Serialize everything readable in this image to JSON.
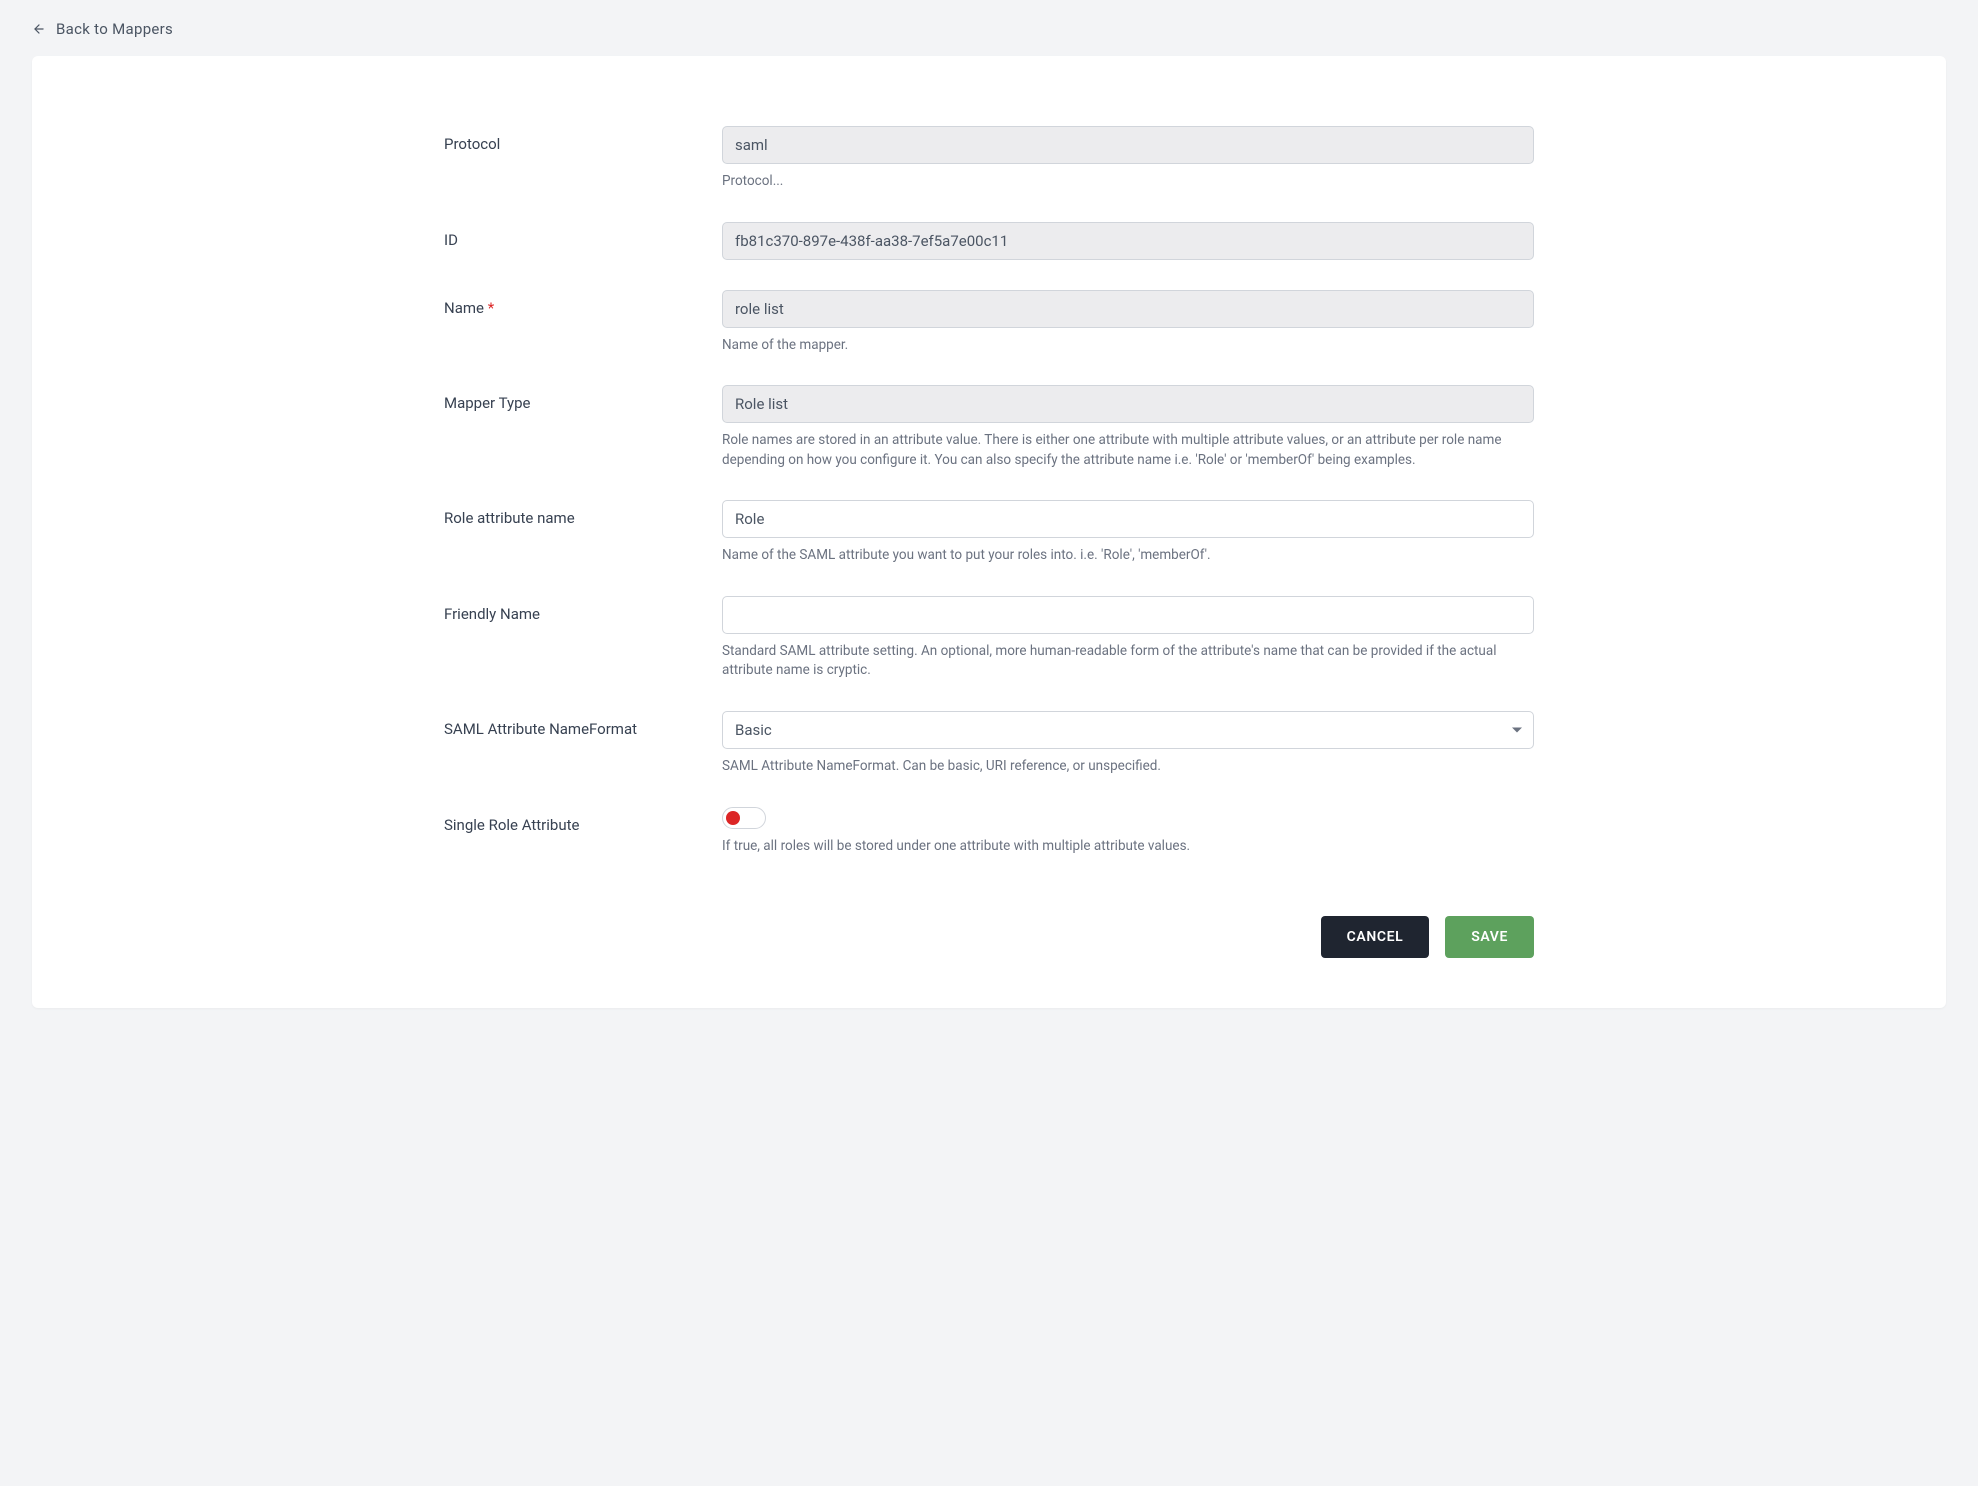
{
  "back": {
    "label": "Back to Mappers"
  },
  "fields": {
    "protocol": {
      "label": "Protocol",
      "value": "saml",
      "help": "Protocol..."
    },
    "id": {
      "label": "ID",
      "value": "fb81c370-897e-438f-aa38-7ef5a7e00c11"
    },
    "name": {
      "label": "Name",
      "required_mark": "*",
      "value": "role list",
      "help": "Name of the mapper."
    },
    "mapperType": {
      "label": "Mapper Type",
      "value": "Role list",
      "help": "Role names are stored in an attribute value. There is either one attribute with multiple attribute values, or an attribute per role name depending on how you configure it. You can also specify the attribute name i.e. 'Role' or 'memberOf' being examples."
    },
    "roleAttrName": {
      "label": "Role attribute name",
      "value": "Role",
      "help": "Name of the SAML attribute you want to put your roles into. i.e. 'Role', 'memberOf'."
    },
    "friendlyName": {
      "label": "Friendly Name",
      "value": "",
      "help": "Standard SAML attribute setting. An optional, more human-readable form of the attribute's name that can be provided if the actual attribute name is cryptic."
    },
    "samlNameFormat": {
      "label": "SAML Attribute NameFormat",
      "value": "Basic",
      "help": "SAML Attribute NameFormat. Can be basic, URI reference, or unspecified."
    },
    "singleRoleAttr": {
      "label": "Single Role Attribute",
      "value": false,
      "help": "If true, all roles will be stored under one attribute with multiple attribute values."
    }
  },
  "actions": {
    "cancel": "CANCEL",
    "save": "SAVE"
  }
}
